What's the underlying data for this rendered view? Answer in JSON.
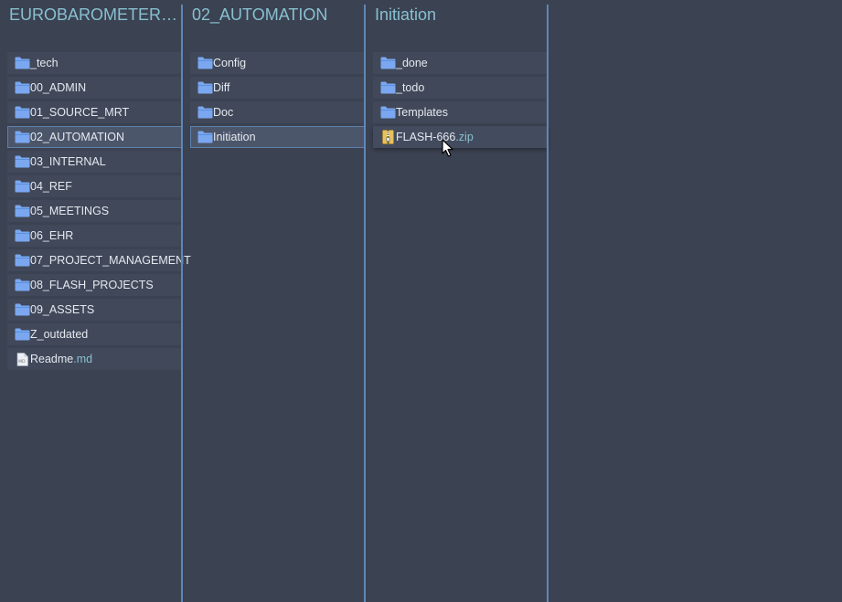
{
  "columns": [
    {
      "title": "EUROBAROMETER_FL...",
      "items": [
        {
          "name": "_tech",
          "ext": "",
          "icon": "folder-icon",
          "selected": false
        },
        {
          "name": "00_ADMIN",
          "ext": "",
          "icon": "folder-icon",
          "selected": false
        },
        {
          "name": "01_SOURCE_MRT",
          "ext": "",
          "icon": "folder-icon",
          "selected": false
        },
        {
          "name": "02_AUTOMATION",
          "ext": "",
          "icon": "folder-icon",
          "selected": true
        },
        {
          "name": "03_INTERNAL",
          "ext": "",
          "icon": "folder-icon",
          "selected": false
        },
        {
          "name": "04_REF",
          "ext": "",
          "icon": "folder-icon",
          "selected": false
        },
        {
          "name": "05_MEETINGS",
          "ext": "",
          "icon": "folder-icon",
          "selected": false
        },
        {
          "name": "06_EHR",
          "ext": "",
          "icon": "folder-icon",
          "selected": false
        },
        {
          "name": "07_PROJECT_MANAGEMENT",
          "ext": "",
          "icon": "folder-icon",
          "selected": false
        },
        {
          "name": "08_FLASH_PROJECTS",
          "ext": "",
          "icon": "folder-icon",
          "selected": false
        },
        {
          "name": "09_ASSETS",
          "ext": "",
          "icon": "folder-icon",
          "selected": false
        },
        {
          "name": "Z_outdated",
          "ext": "",
          "icon": "folder-icon",
          "selected": false
        },
        {
          "name": "Readme",
          "ext": ".md",
          "icon": "markdown-file-icon",
          "selected": false
        }
      ]
    },
    {
      "title": "02_AUTOMATION",
      "items": [
        {
          "name": "Config",
          "ext": "",
          "icon": "folder-icon",
          "selected": false
        },
        {
          "name": "Diff",
          "ext": "",
          "icon": "folder-icon",
          "selected": false
        },
        {
          "name": "Doc",
          "ext": "",
          "icon": "folder-icon",
          "selected": false
        },
        {
          "name": "Initiation",
          "ext": "",
          "icon": "folder-icon",
          "selected": true
        }
      ]
    },
    {
      "title": "Initiation",
      "items": [
        {
          "name": "_done",
          "ext": "",
          "icon": "folder-icon",
          "selected": false
        },
        {
          "name": "_todo",
          "ext": "",
          "icon": "folder-icon",
          "selected": false
        },
        {
          "name": "Templates",
          "ext": "",
          "icon": "folder-icon",
          "selected": false
        },
        {
          "name": "FLASH-666",
          "ext": ".zip",
          "icon": "zip-file-icon",
          "selected": false,
          "hover": true
        }
      ]
    }
  ],
  "colors": {
    "background": "#3b4252",
    "row": "#404859",
    "selected_row": "#4c566a",
    "divider": "#5f87b6",
    "title": "#88c0d0",
    "folder": "#7aa7f0",
    "text": "#e5e9f0",
    "extension": "#88c0d0"
  }
}
